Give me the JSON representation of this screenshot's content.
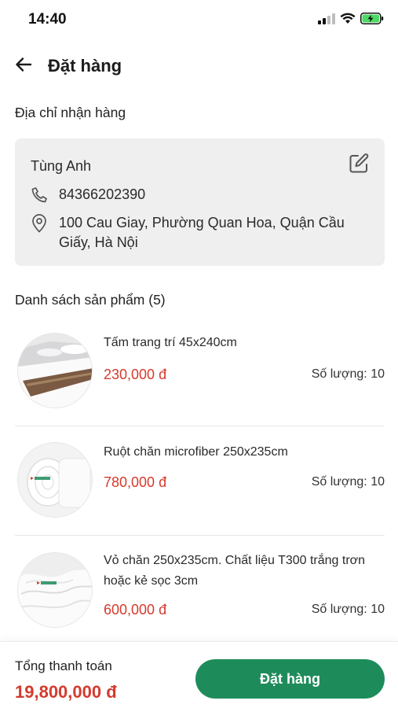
{
  "status_bar": {
    "time": "14:40"
  },
  "header": {
    "title": "Đặt hàng"
  },
  "address_section": {
    "title": "Địa chỉ nhận hàng",
    "name": "Tùng Anh",
    "phone": "84366202390",
    "address": "100 Cau Giay, Phường Quan Hoa, Quận Cầu Giấy, Hà Nội"
  },
  "products_section": {
    "title": "Danh sách sản phẩm (5)",
    "items": [
      {
        "name": "Tấm trang trí 45x240cm",
        "price": "230,000 đ",
        "quantity": "Số lượng: 10",
        "image": "bed-runner-image"
      },
      {
        "name": "Ruột chăn microfiber 250x235cm",
        "price": "780,000 đ",
        "quantity": "Số lượng: 10",
        "image": "duvet-insert-image"
      },
      {
        "name": "Vỏ chăn 250x235cm. Chất liệu T300 trắng trơn hoặc kẻ sọc 3cm",
        "price": "600,000 đ",
        "quantity": "Số lượng: 10",
        "image": "duvet-cover-image"
      }
    ]
  },
  "footer": {
    "total_label": "Tổng thanh toán",
    "total_value": "19,800,000 đ",
    "order_button": "Đặt hàng"
  },
  "colors": {
    "accent": "#1e8c5a",
    "price": "#d53a2e",
    "card_bg": "#efefef",
    "battery": "#4cd964"
  }
}
